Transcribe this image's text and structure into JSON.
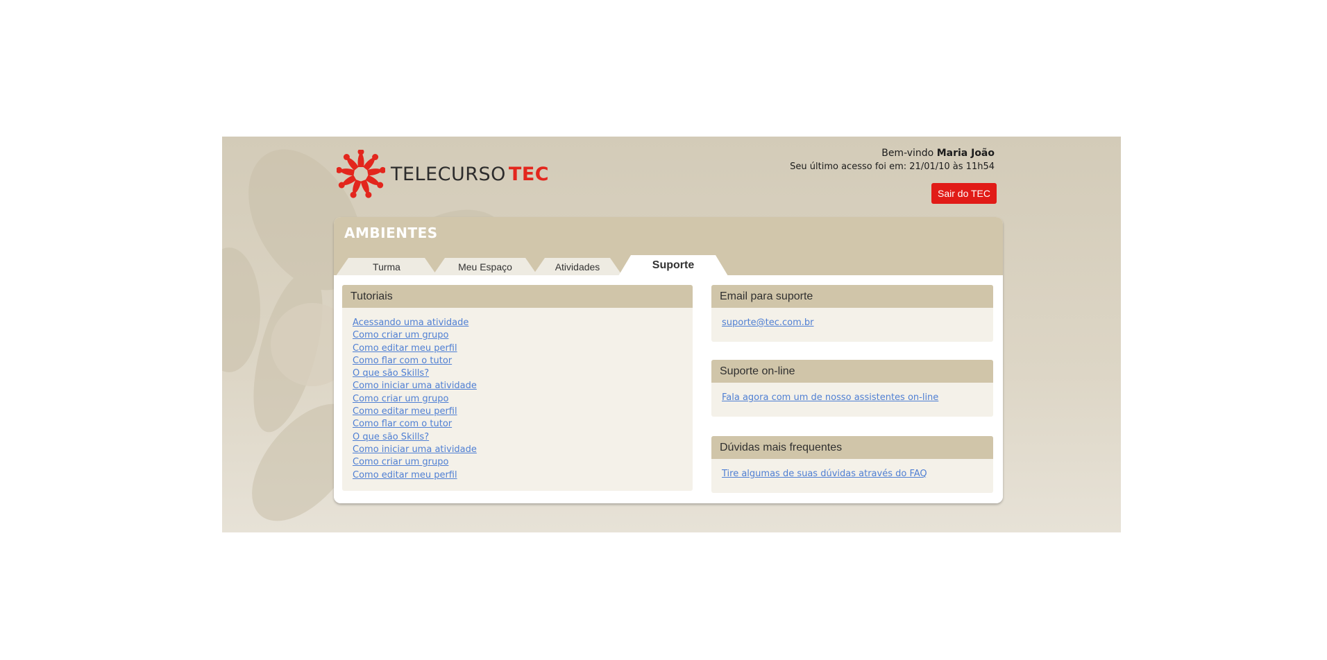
{
  "brand": {
    "name_part1": "TELECURSO",
    "name_part2": "TEC",
    "accent": "#e3261d"
  },
  "user": {
    "welcome_prefix": "Bem-vindo",
    "name": "Maria João",
    "last_access": "Seu último acesso foi em: 21/01/10 às 11h54",
    "logout_label": "Sair do TEC"
  },
  "ambientes": {
    "title": "AMBIENTES",
    "tabs": [
      {
        "label": "Turma",
        "active": false
      },
      {
        "label": "Meu Espaço",
        "active": false
      },
      {
        "label": "Atividades",
        "active": false
      },
      {
        "label": "Suporte",
        "active": true
      }
    ]
  },
  "tutoriais": {
    "title": "Tutoriais",
    "links": [
      "Acessando uma atividade",
      "Como criar um grupo",
      "Como editar meu perfil",
      "Como flar com o tutor",
      "O que são Skills?",
      "Como iniciar uma atividade",
      "Como criar um grupo",
      "Como editar meu perfil",
      "Como flar com o tutor",
      "O que são Skills?",
      "Como iniciar uma atividade",
      "Como criar um grupo",
      "Como editar meu perfil"
    ]
  },
  "email_suporte": {
    "title": "Email para suporte",
    "link": "suporte@tec.com.br"
  },
  "suporte_online": {
    "title": "Suporte on-line",
    "link": "Fala agora com um de nosso assistentes on-line"
  },
  "faq": {
    "title": "Dúvidas mais frequentes",
    "link": "Tire algumas de suas dúvidas através do FAQ"
  },
  "colors": {
    "header_tan": "#d1c6ab",
    "box_bg": "#f4f1e9",
    "link_blue": "#4f7fd3",
    "logout_red": "#e11b17"
  }
}
